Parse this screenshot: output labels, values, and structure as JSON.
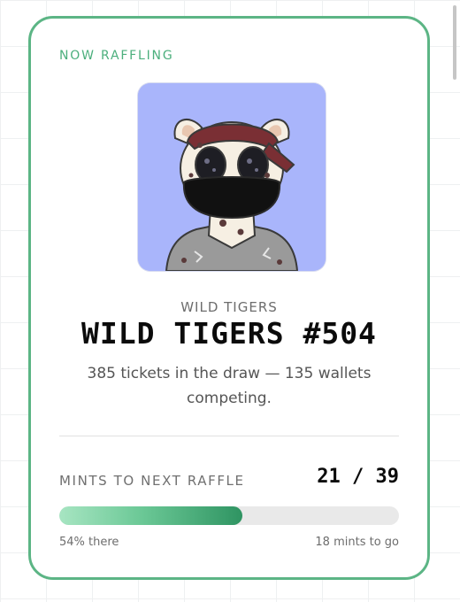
{
  "eyebrow": "NOW RAFFLING",
  "nft": {
    "collection": "WILD TIGERS",
    "title": "WILD TIGERS #504",
    "image_background": "#a9b5fb"
  },
  "description": "385 tickets in the draw — 135 wallets competing.",
  "progress": {
    "label": "MINTS TO NEXT RAFFLE",
    "count_text": "21 / 39",
    "fraction": 0.54,
    "percent_text": "54% there",
    "remaining_text": "18 mints to go"
  },
  "colors": {
    "accent": "#5cb585",
    "eyebrow": "#4caf7d",
    "progress_fill_end": "#2f9462",
    "track": "#e9e9e9"
  }
}
